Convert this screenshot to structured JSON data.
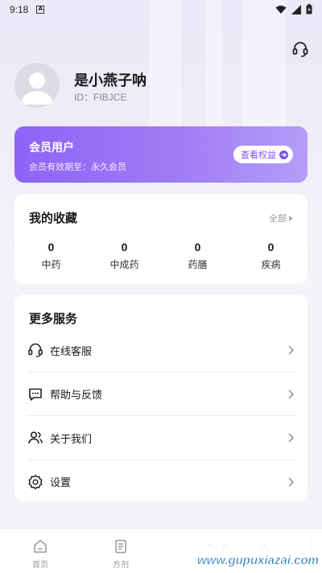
{
  "status_bar": {
    "time": "9:18",
    "notification_badge": "A"
  },
  "profile": {
    "name": "是小燕子呐",
    "id_text": "ID：FIBJCE"
  },
  "membership": {
    "title": "会员用户",
    "expiry": "会员有效期至：永久会员",
    "button_label": "查看权益",
    "gradient_start": "#8d63f6",
    "gradient_end": "#b59df8"
  },
  "favorites": {
    "title": "我的收藏",
    "all_label": "全部",
    "stats": [
      {
        "count": "0",
        "label": "中药"
      },
      {
        "count": "0",
        "label": "中成药"
      },
      {
        "count": "0",
        "label": "药膳"
      },
      {
        "count": "0",
        "label": "疾病"
      }
    ]
  },
  "services": {
    "title": "更多服务",
    "items": [
      {
        "label": "在线客服",
        "icon": "headset-icon"
      },
      {
        "label": "帮助与反馈",
        "icon": "chat-bubble-icon"
      },
      {
        "label": "关于我们",
        "icon": "users-icon"
      },
      {
        "label": "设置",
        "icon": "gear-icon"
      }
    ]
  },
  "tabbar": {
    "tabs": [
      {
        "label": "首页",
        "icon": "home-icon"
      },
      {
        "label": "方剂",
        "icon": "document-icon"
      }
    ]
  },
  "watermark": {
    "title": "谷普软件园",
    "url": "www.gupuxiazai.com"
  },
  "colors": {
    "accent": "#7d56f0",
    "background": "#f4f4f8"
  }
}
